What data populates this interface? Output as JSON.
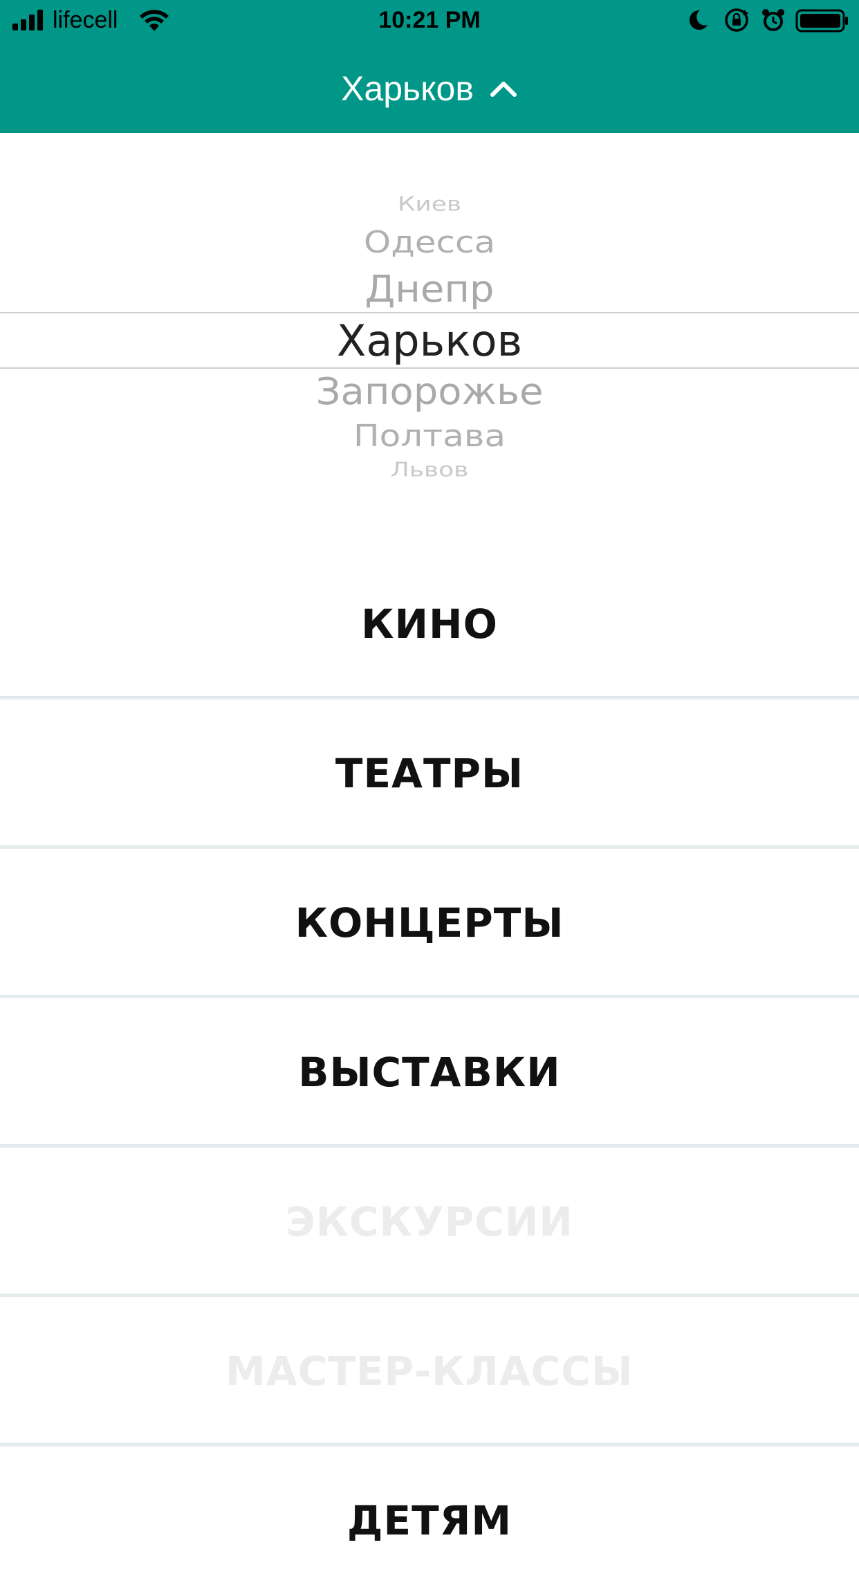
{
  "status_bar": {
    "carrier": "lifecell",
    "time": "10:21 PM"
  },
  "header": {
    "title": "Харьков",
    "background": "#009688"
  },
  "picker": {
    "items": [
      "Киев",
      "Одесса",
      "Днепр",
      "Харьков",
      "Запорожье",
      "Полтава",
      "Львов"
    ],
    "selected": "Харьков"
  },
  "categories": [
    {
      "label": "КИНО",
      "enabled": true
    },
    {
      "label": "ТЕАТРЫ",
      "enabled": true
    },
    {
      "label": "КОНЦЕРТЫ",
      "enabled": true
    },
    {
      "label": "ВЫСТАВКИ",
      "enabled": true
    },
    {
      "label": "ЭКСКУРСИИ",
      "enabled": false
    },
    {
      "label": "МАСТЕР-КЛАССЫ",
      "enabled": false
    },
    {
      "label": "ДЕТЯМ",
      "enabled": true
    }
  ]
}
